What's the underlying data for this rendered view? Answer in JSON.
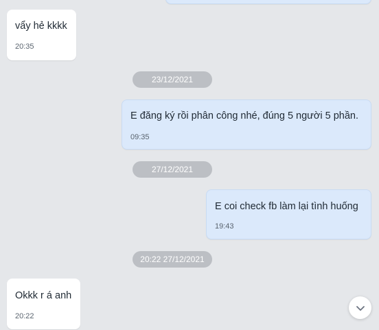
{
  "messages": [
    {
      "text": "vẩy hẻ kkkk",
      "time": "20:35"
    },
    {
      "text": "E đăng ký rồi phân công nhé, đúng 5 người 5 phần.",
      "time": "09:35"
    },
    {
      "text": "E coi check fb làm lại tình huống",
      "time": "19:43"
    },
    {
      "text": "Okkk r á anh",
      "time": "20:22"
    }
  ],
  "date_separators": [
    "23/12/2021",
    "27/12/2021",
    "20:22 27/12/2021"
  ],
  "scroll_button": {
    "icon": "chevron-down-icon"
  }
}
